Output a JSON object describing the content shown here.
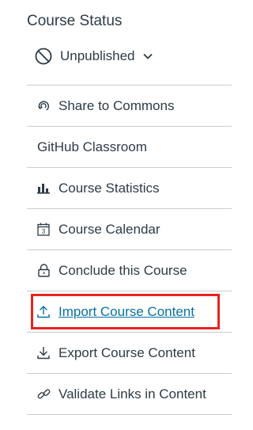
{
  "course_status": {
    "heading": "Course Status",
    "status_label": "Unpublished"
  },
  "menu": {
    "items": [
      {
        "label": "Share to Commons",
        "icon": "commons-icon"
      },
      {
        "label": "GitHub Classroom",
        "icon": ""
      },
      {
        "label": "Course Statistics",
        "icon": "bar-chart-icon"
      },
      {
        "label": "Course Calendar",
        "icon": "calendar-icon"
      },
      {
        "label": "Conclude this Course",
        "icon": "lock-icon"
      },
      {
        "label": "Import Course Content",
        "icon": "upload-icon"
      },
      {
        "label": "Export Course Content",
        "icon": "download-icon"
      },
      {
        "label": "Validate Links in Content",
        "icon": "link-icon"
      }
    ],
    "calendar_icon_day": "3"
  },
  "colors": {
    "text": "#2d3b45",
    "link": "#0770a3",
    "divider": "#c7cdd1",
    "highlight_box": "#e8231e"
  }
}
